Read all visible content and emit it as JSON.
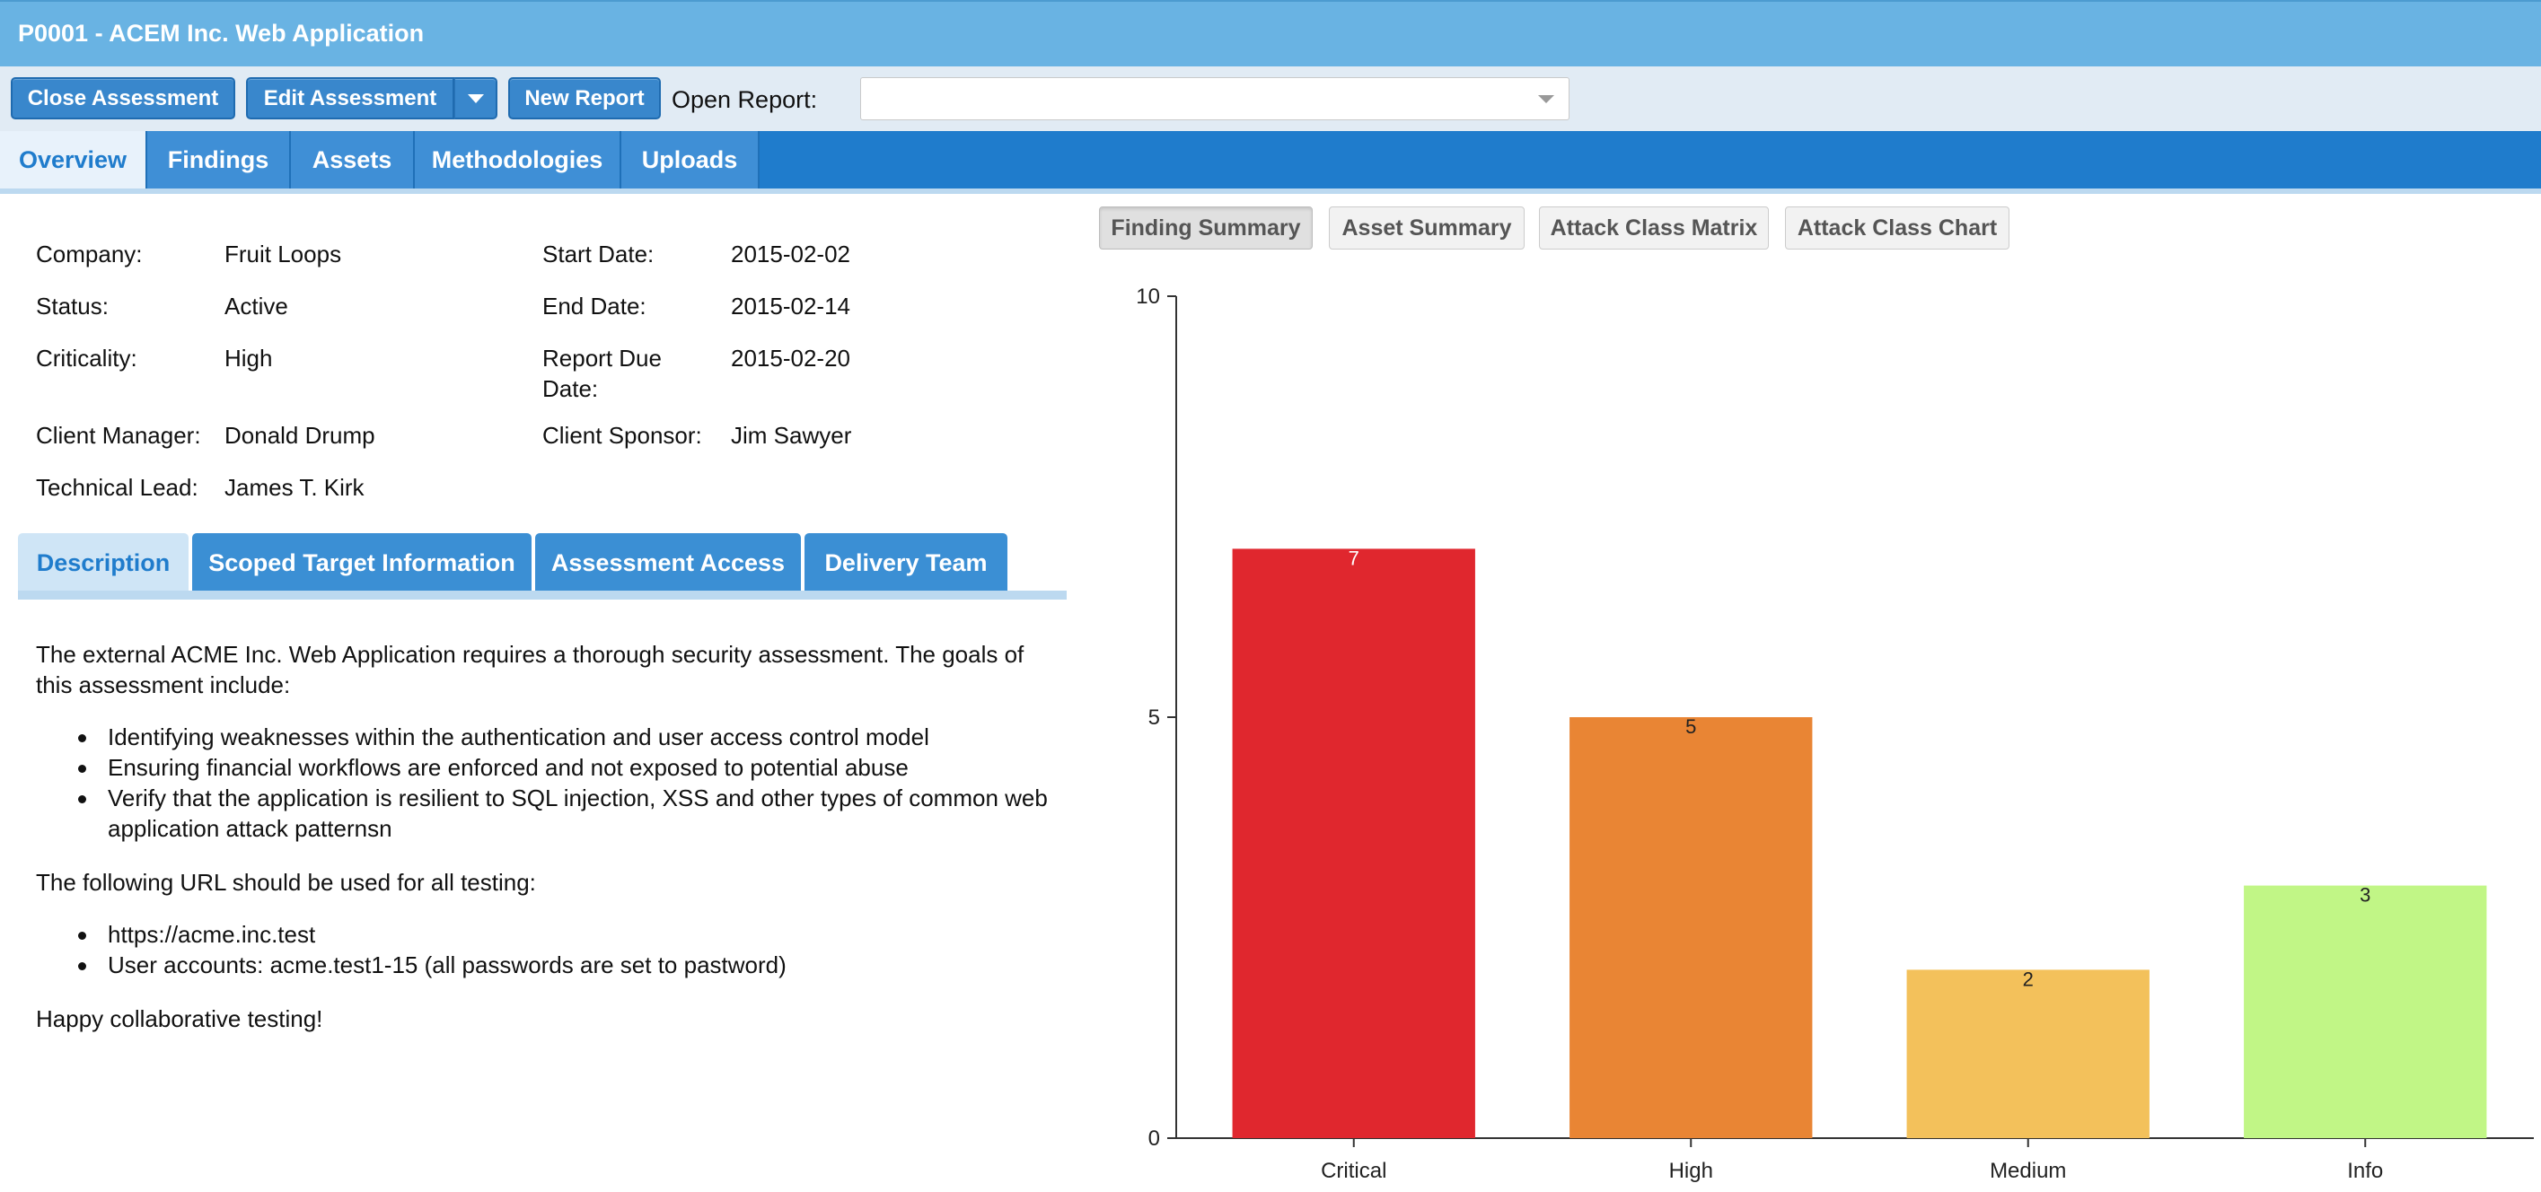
{
  "window": {
    "title": "P0001 - ACEM Inc. Web Application"
  },
  "toolbar": {
    "close_assessment": "Close Assessment",
    "edit_assessment": "Edit Assessment",
    "new_report": "New Report",
    "open_report_label": "Open Report:",
    "open_report_value": ""
  },
  "tabs": [
    {
      "label": "Overview",
      "active": true
    },
    {
      "label": "Findings"
    },
    {
      "label": "Assets"
    },
    {
      "label": "Methodologies"
    },
    {
      "label": "Uploads"
    }
  ],
  "info": {
    "company_label": "Company:",
    "company": "Fruit Loops",
    "status_label": "Status:",
    "status": "Active",
    "criticality_label": "Criticality:",
    "criticality": "High",
    "client_manager_label": "Client Manager:",
    "client_manager": "Donald Drump",
    "technical_lead_label": "Technical Lead:",
    "technical_lead": "James T. Kirk",
    "start_date_label": "Start Date:",
    "start_date": "2015-02-02",
    "end_date_label": "End Date:",
    "end_date": "2015-02-14",
    "report_due_label_1": "Report Due",
    "report_due_label_2": "Date:",
    "report_due": "2015-02-20",
    "client_sponsor_label": "Client Sponsor:",
    "client_sponsor": "Jim Sawyer"
  },
  "subtabs": [
    {
      "label": "Description",
      "active": true
    },
    {
      "label": "Scoped Target Information"
    },
    {
      "label": "Assessment Access"
    },
    {
      "label": "Delivery Team"
    }
  ],
  "description": {
    "intro": "The external ACME Inc. Web Application requires a thorough security assessment. The goals of this assessment include:",
    "goals": [
      "Identifying weaknesses within the authentication and user access control model",
      "Ensuring financial workflows are enforced and not exposed to potential abuse",
      "Verify that the application is resilient to SQL injection, XSS and other types of common web application attack patternsn"
    ],
    "url_intro": "The following URL should be used for all testing:",
    "urls": [
      "https://acme.inc.test",
      "User accounts: acme.test1-15 (all passwords are set to pastword)"
    ],
    "closing": "Happy collaborative testing!"
  },
  "chart_buttons": [
    {
      "label": "Finding Summary",
      "active": true
    },
    {
      "label": "Asset Summary"
    },
    {
      "label": "Attack Class Matrix"
    },
    {
      "label": "Attack Class Chart"
    }
  ],
  "chart_data": {
    "type": "bar",
    "categories": [
      "Critical",
      "High",
      "Medium",
      "Info"
    ],
    "values": [
      7,
      5,
      2,
      3
    ],
    "colors": [
      "#e0272e",
      "#e98534",
      "#f3c15b",
      "#c1f686"
    ],
    "label_colors": [
      "#ffffff",
      "#222222",
      "#222222",
      "#222222"
    ],
    "ylim": [
      0,
      10
    ],
    "yticks": [
      0,
      5,
      10
    ],
    "title": "",
    "xlabel": "",
    "ylabel": ""
  }
}
